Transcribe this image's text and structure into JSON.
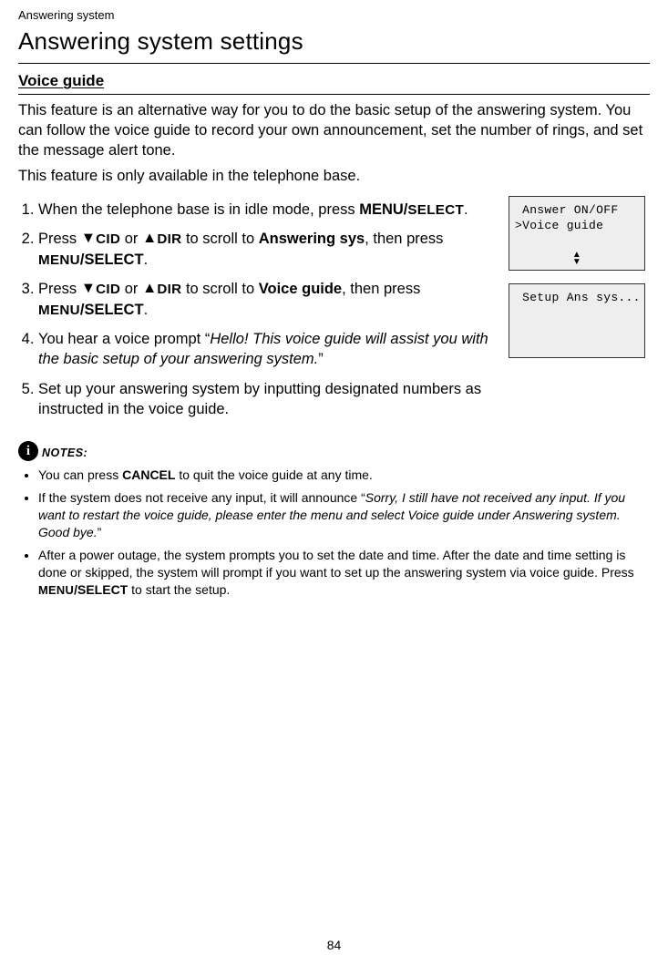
{
  "breadcrumb": "Answering system",
  "title": "Answering system settings",
  "subheading": "Voice guide",
  "intro1": "This feature is an alternative way for you to do the basic setup of the answering system. You can follow the voice guide to record your own announcement, set the number of rings, and set the message alert tone.",
  "intro2": "This feature is only available in the telephone base.",
  "steps": {
    "s1_a": "When the telephone base is in idle mode, press ",
    "s1_b": "MENU/",
    "s1_c": "SELECT",
    "s1_d": ".",
    "s2_a": "Press ",
    "s2_cid": "CID",
    "s2_or": " or ",
    "s2_dir": "DIR",
    "s2_b": " to scroll to ",
    "s2_target": "Answering sys",
    "s2_c": ", then press ",
    "s2_menu": "MENU",
    "s2_sel": "/SELECT",
    "s2_d": ".",
    "s3_a": "Press ",
    "s3_b": " to scroll to ",
    "s3_target": "Voice guide",
    "s3_c": ", then press ",
    "s3_d": ".",
    "s4_a": "You hear a voice prompt “",
    "s4_q": "Hello! This voice guide will assist you with the basic setup of your answering system.",
    "s4_b": "”",
    "s5": "Set up your answering system by inputting designated numbers as instructed in the voice guide."
  },
  "lcd1": {
    "line1": " Answer ON/OFF",
    "line2": ">Voice guide"
  },
  "lcd2": {
    "line1": " Setup Ans sys..."
  },
  "notes_label": "NOTES:",
  "notes": {
    "n1_a": "You can press ",
    "n1_b": "CANCEL",
    "n1_c": " to quit the voice guide at any time.",
    "n2_a": "If the system does not receive any input, it will announce “",
    "n2_q": "Sorry, I still have not received any input. If you want to restart the voice guide, please enter the menu and select Voice guide under Answering system. Good bye.",
    "n2_b": "”",
    "n3_a": "After a power outage, the system prompts you to set the date and time. After the date and time setting is done or skipped, the system will prompt if you want to set up the answering system via voice guide. Press ",
    "n3_menu": "MENU",
    "n3_sel": "/SELECT",
    "n3_b": " to start the setup."
  },
  "page_number": "84"
}
